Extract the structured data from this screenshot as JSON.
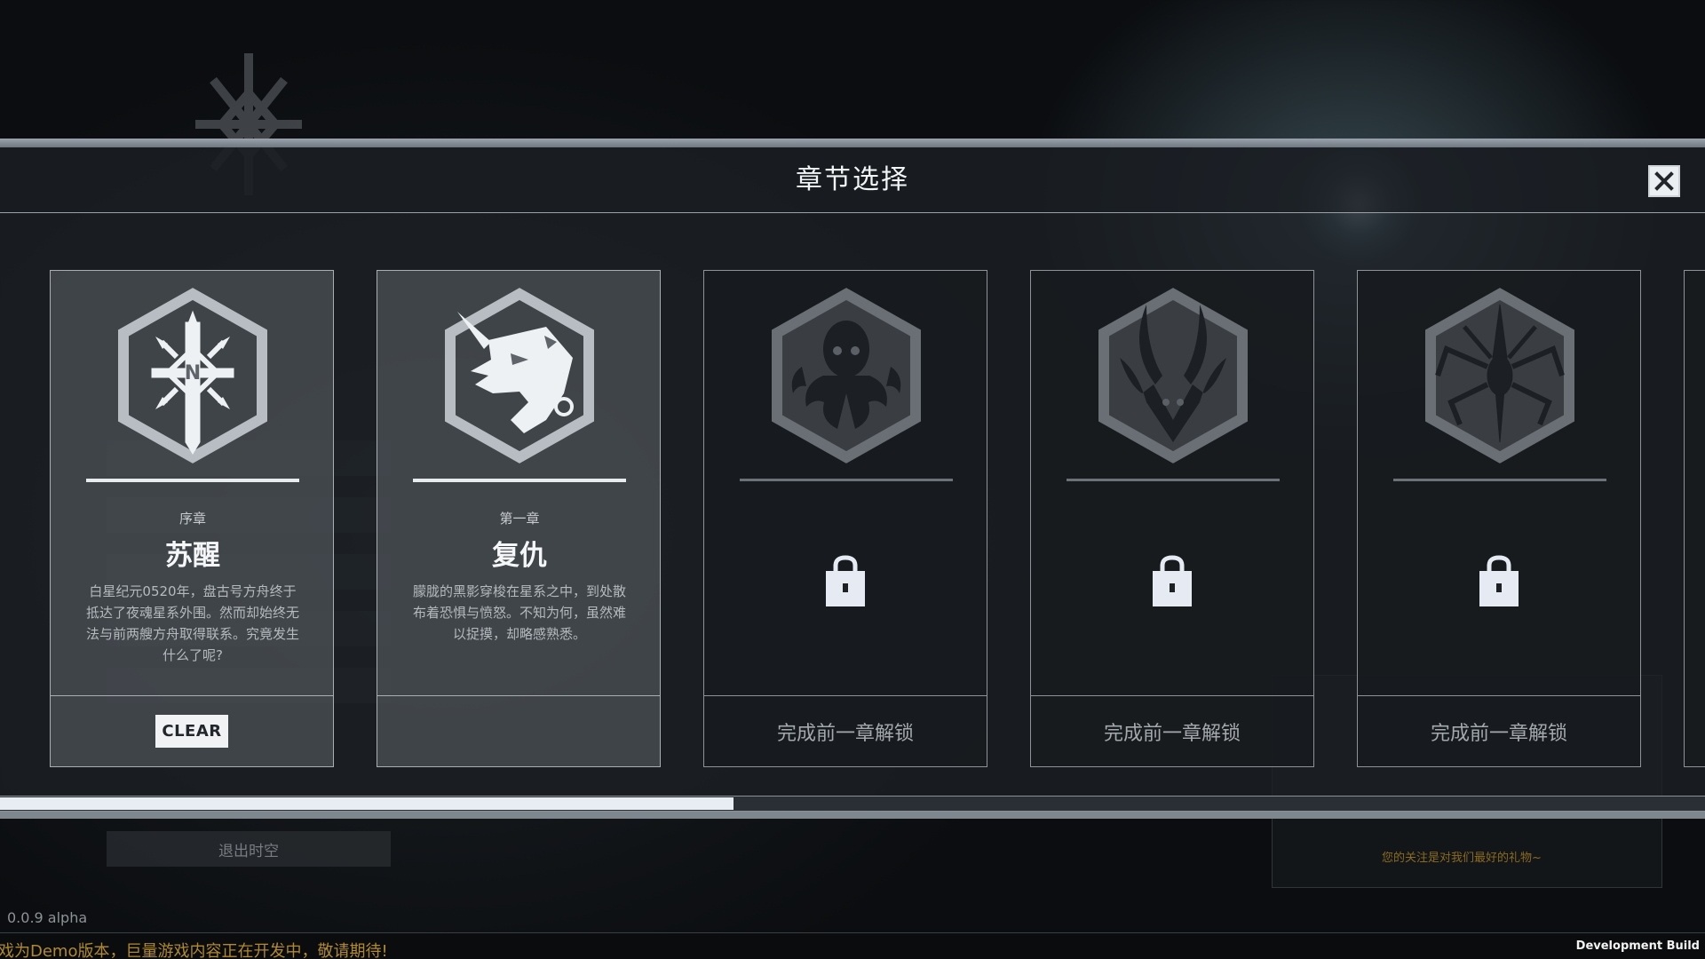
{
  "dialog": {
    "title": "章节选择",
    "close_icon": "close-icon"
  },
  "chapters": [
    {
      "chapter_label": "序章",
      "name": "苏醒",
      "description": "白星纪元0520年，盘古号方舟终于抵达了夜魂星系外围。然而却始终无法与前两艘方舟取得联系。究竟发生什么了呢?",
      "status": "CLEAR",
      "emblem": "sword-star-emblem",
      "locked": false
    },
    {
      "chapter_label": "第一章",
      "name": "复仇",
      "description": "朦胧的黑影穿梭在星系之中，到处散布着恐惧与愤怒。不知为何，虽然难以捉摸，却略感熟悉。",
      "status": "",
      "emblem": "dragon-head-emblem",
      "locked": false
    },
    {
      "lock_text": "完成前一章解锁",
      "emblem": "kraken-emblem",
      "locked": true
    },
    {
      "lock_text": "完成前一章解锁",
      "emblem": "horned-beast-emblem",
      "locked": true
    },
    {
      "lock_text": "完成前一章解锁",
      "emblem": "spider-emblem",
      "locked": true
    }
  ],
  "scrollbar": {
    "position_fraction": 0.43
  },
  "background": {
    "exit_label": "退出时空",
    "panel_gold_text": "您的关注是对我们最好的礼物~"
  },
  "footer": {
    "version": "0.0.9 alpha",
    "marquee": "戏为Demo版本，巨量游戏内容正在开发中，敬请期待!",
    "dev_build": "Development Build"
  }
}
